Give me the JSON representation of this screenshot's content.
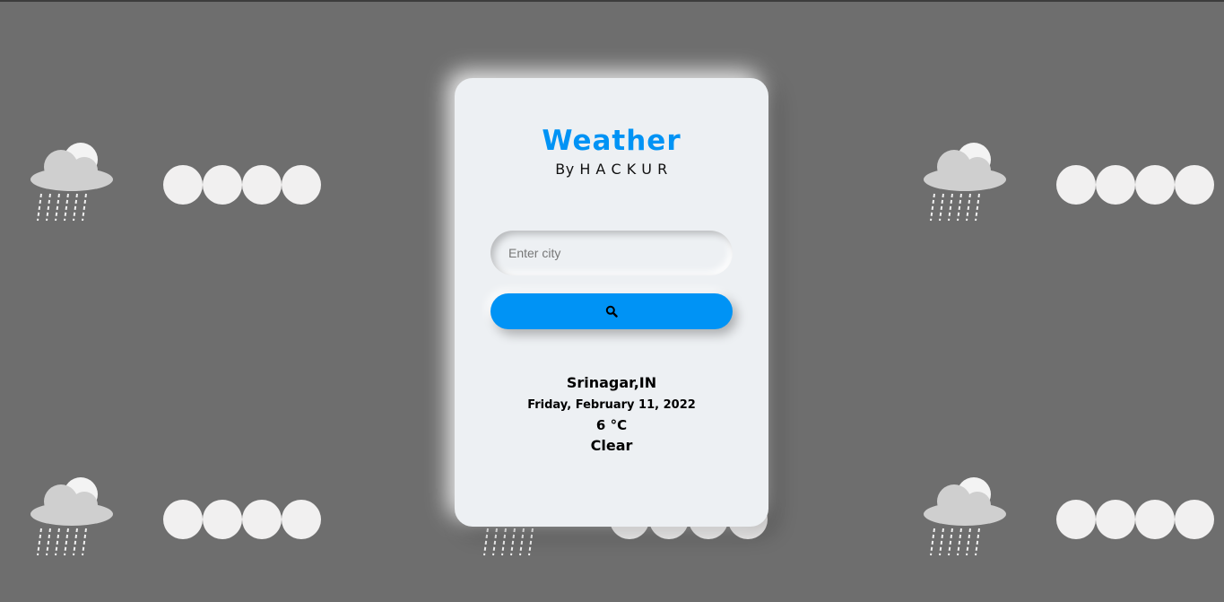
{
  "app": {
    "title": "Weather",
    "byline": "By H A C K U R"
  },
  "search": {
    "placeholder": "Enter city",
    "button_icon": "search-icon"
  },
  "weather": {
    "location": "Srinagar,IN",
    "date": "Friday, February 11, 2022",
    "temperature": "6 °C",
    "condition": "Clear"
  },
  "background": {
    "icons": [
      "rain-cloud-sun-icon",
      "cloud-puffs-icon"
    ]
  },
  "colors": {
    "accent": "#0093f5",
    "card": "#edf0f3",
    "background": "#6e6e6e"
  }
}
